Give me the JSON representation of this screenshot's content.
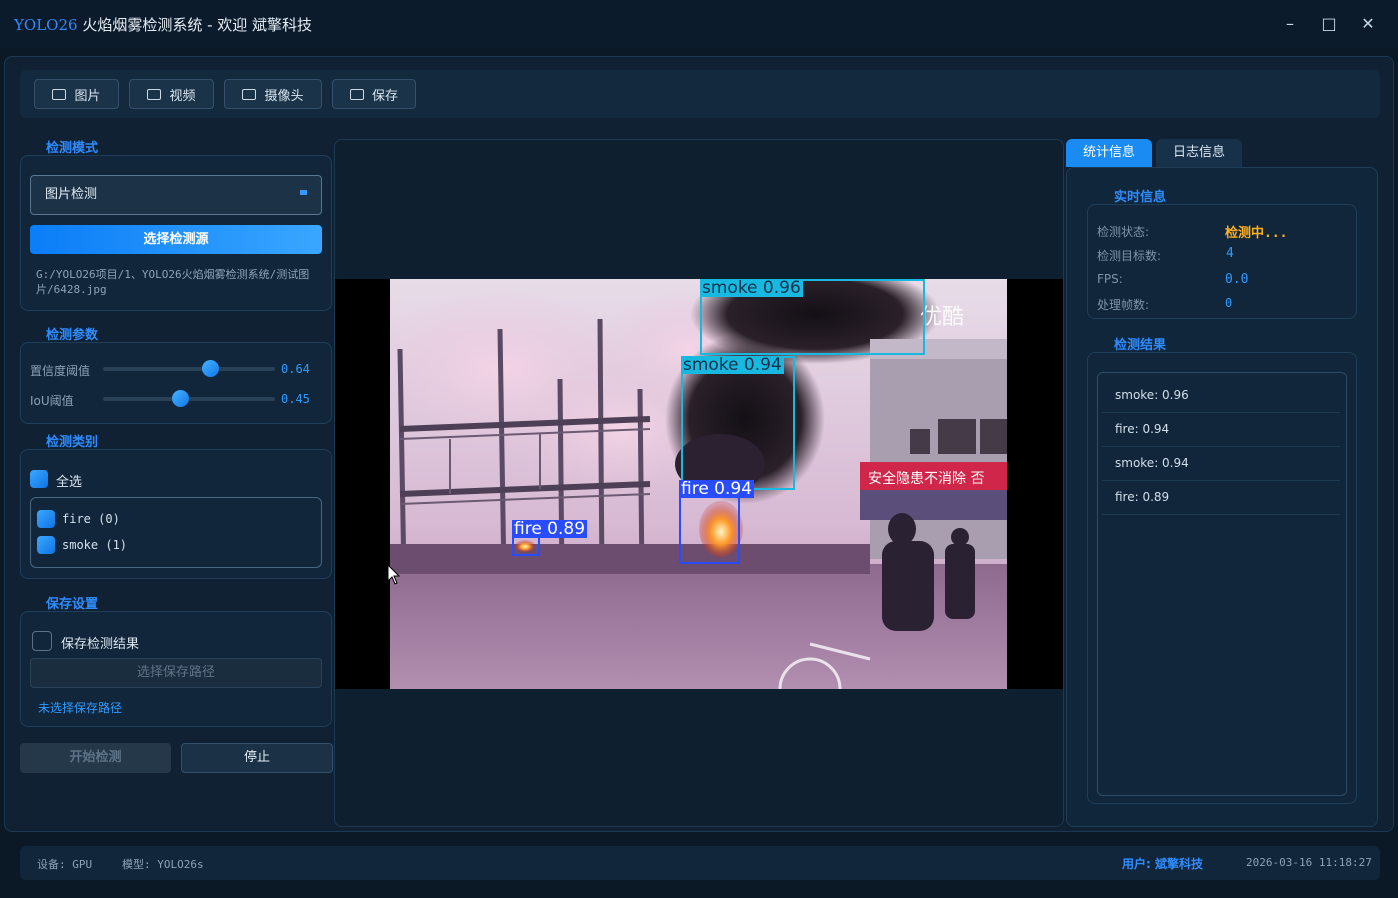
{
  "window": {
    "brand": "YOLO26",
    "title": " 火焰烟雾检测系统 - 欢迎 斌擎科技",
    "minimize": "–",
    "maximize": "□",
    "close": "✕"
  },
  "toolbar": {
    "image_label": "图片",
    "video_label": "视频",
    "camera_label": "摄像头",
    "save_label": "保存"
  },
  "detection_mode": {
    "title": "检测模式",
    "selected": "图片检测",
    "choose_source_label": "选择检测源",
    "source_path": "G:/YOLO26项目/1、YOLO26火焰烟雾检测系统/测试图片/6428.jpg"
  },
  "detection_params": {
    "title": "检测参数",
    "confidence_label": "置信度阈值",
    "confidence_value": "0.64",
    "confidence": 0.64,
    "iou_label": "IoU阈值",
    "iou_value": "0.45",
    "iou": 0.45
  },
  "classes": {
    "title": "检测类别",
    "select_all_label": "全选",
    "items": [
      {
        "label": "fire  (0)"
      },
      {
        "label": "smoke  (1)"
      }
    ]
  },
  "save_settings": {
    "title": "保存设置",
    "save_results_label": "保存检测结果",
    "choose_path_label": "选择保存路径",
    "no_path_label": "未选择保存路径"
  },
  "actions": {
    "start_label": "开始检测",
    "stop_label": "停止"
  },
  "video": {
    "watermark": "优酷",
    "banner_text": "安全隐患不消除 否"
  },
  "detections": [
    {
      "label": "smoke 0.96",
      "color": "#18b9e0"
    },
    {
      "label": "smoke 0.94",
      "color": "#18b9e0"
    },
    {
      "label": "fire 0.94",
      "color": "#2a4cff"
    },
    {
      "label": "fire 0.89",
      "color": "#2a4cff"
    }
  ],
  "right_panel": {
    "tab_stats": "统计信息",
    "tab_log": "日志信息",
    "realtime_title": "实时信息",
    "status_label": "检测状态:",
    "status_value": "检测中...",
    "targets_label": "检测目标数:",
    "targets_value": "4",
    "fps_label": "FPS:",
    "fps_value": "0.0",
    "frames_label": "处理帧数:",
    "frames_value": "0",
    "results_title": "检测结果",
    "results": [
      "smoke: 0.96",
      "fire: 0.94",
      "smoke: 0.94",
      "fire: 0.89"
    ]
  },
  "status_bar": {
    "device": "设备: GPU",
    "model": "模型: YOLO26s",
    "user": "用户: 斌擎科技",
    "datetime": "2026-03-16 11:18:27"
  },
  "colors": {
    "accent": "#2f8cff",
    "status_active": "#ffb020",
    "background": "#0b1826"
  }
}
